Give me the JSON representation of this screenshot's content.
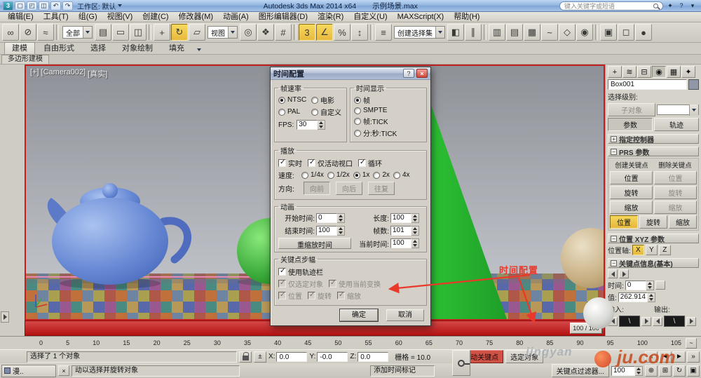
{
  "titlebar": {
    "qat_icons": [
      {
        "name": "app-icon",
        "glyph": "3"
      },
      {
        "name": "new-scene-icon",
        "glyph": "▢"
      },
      {
        "name": "open-file-icon",
        "glyph": "◰"
      },
      {
        "name": "save-file-icon",
        "glyph": "◫"
      },
      {
        "name": "undo-icon",
        "glyph": "↶"
      },
      {
        "name": "redo-icon",
        "glyph": "↷"
      }
    ],
    "workspace_label": "工作区: 默认",
    "app_title": "Autodesk 3ds Max  2014 x64",
    "file_name": "示例场景.max",
    "search_placeholder": "键入关键字或短语",
    "right_icons": [
      {
        "name": "community-icon",
        "glyph": "✦"
      },
      {
        "name": "help-icon",
        "glyph": "?"
      },
      {
        "name": "help-menu-arrow-icon",
        "glyph": "▾"
      }
    ]
  },
  "menubar": {
    "items": [
      "编辑(E)",
      "工具(T)",
      "组(G)",
      "视图(V)",
      "创建(C)",
      "修改器(M)",
      "动画(A)",
      "图形编辑器(D)",
      "渲染(R)",
      "自定义(U)",
      "MAXScript(X)",
      "帮助(H)"
    ]
  },
  "toolbar": {
    "icons": [
      {
        "name": "select-and-link-icon",
        "glyph": "∞"
      },
      {
        "name": "unlink-selection-icon",
        "glyph": "⊘"
      },
      {
        "name": "bind-to-space-warp-icon",
        "glyph": "≈"
      },
      {
        "sep": true
      },
      {
        "name": "selection-filter-combo",
        "combo": "全部"
      },
      {
        "name": "select-by-name-icon",
        "glyph": "▤"
      },
      {
        "name": "selection-region-icon",
        "glyph": "▭"
      },
      {
        "name": "window-crossing-icon",
        "glyph": "◫"
      },
      {
        "sep": true
      },
      {
        "name": "select-and-move-icon",
        "glyph": "+"
      },
      {
        "name": "select-and-rotate-icon",
        "glyph": "↻",
        "pressed": true
      },
      {
        "name": "select-and-scale-icon",
        "glyph": "▱"
      },
      {
        "name": "reference-coordinate-combo",
        "combo": "视图"
      },
      {
        "name": "use-pivot-point-icon",
        "glyph": "◎"
      },
      {
        "name": "select-and-manipulate-icon",
        "glyph": "❖"
      },
      {
        "name": "keyboard-shortcut-override-icon",
        "glyph": "#"
      },
      {
        "sep": true
      },
      {
        "name": "snap-toggle-3d-icon",
        "glyph": "3",
        "pressed": true
      },
      {
        "name": "angle-snap-icon",
        "glyph": "∠",
        "pressed": true
      },
      {
        "name": "percent-snap-icon",
        "glyph": "%"
      },
      {
        "name": "spinner-snap-icon",
        "glyph": "↕"
      },
      {
        "sep": true
      },
      {
        "name": "edit-named-selections-icon",
        "glyph": "≡"
      },
      {
        "name": "named-selection-sets-combo",
        "combo": "创建选择集"
      },
      {
        "name": "mirror-icon",
        "glyph": "◧"
      },
      {
        "name": "align-icon",
        "glyph": "∥"
      },
      {
        "sep": true
      },
      {
        "name": "scene-explorer-icon",
        "glyph": "▥"
      },
      {
        "name": "layer-explorer-icon",
        "glyph": "▤"
      },
      {
        "name": "ribbon-toggle-icon",
        "glyph": "▦"
      },
      {
        "name": "curve-editor-icon",
        "glyph": "~"
      },
      {
        "name": "schematic-view-icon",
        "glyph": "◇"
      },
      {
        "name": "material-editor-icon",
        "glyph": "◉"
      },
      {
        "sep": true
      },
      {
        "name": "render-setup-icon",
        "glyph": "▣"
      },
      {
        "name": "rendered-frame-window-icon",
        "glyph": "◻"
      },
      {
        "name": "render-production-icon",
        "glyph": "●"
      }
    ]
  },
  "ribbon": {
    "tabs": [
      "建模",
      "自由形式",
      "选择",
      "对象绘制",
      "填充"
    ],
    "active_tab": "建模",
    "subtab": "多边形建模"
  },
  "viewport": {
    "label_general": "[+]",
    "label_pov": "[Camera002]",
    "label_shading": "[真实]",
    "time_slider_value": "100 / 100"
  },
  "annotation": {
    "text": "时间配置",
    "color": "#e8392b"
  },
  "dialog": {
    "title": "时间配置",
    "frame_rate": {
      "title": "帧速率",
      "ntsc": "NTSC",
      "film": "电影",
      "pal": "PAL",
      "custom": "自定义",
      "fps_label": "FPS:",
      "fps_value": "30"
    },
    "time_display": {
      "title": "时间显示",
      "frames": "帧",
      "smpte": "SMPTE",
      "frame_tick": "帧:TICK",
      "min_sec_tick": "分:秒:TICK"
    },
    "playback": {
      "title": "播放",
      "realtime": "实时",
      "active_only": "仅活动视口",
      "loop": "循环",
      "speed_label": "速度:",
      "speeds": [
        "1/4x",
        "1/2x",
        "1x",
        "2x",
        "4x"
      ],
      "direction_label": "方向:",
      "forward": "向前",
      "backward": "向后",
      "pingpong": "往复"
    },
    "animation": {
      "title": "动画",
      "start_label": "开始时间:",
      "start_value": "0",
      "length_label": "长度:",
      "length_value": "100",
      "end_label": "结束时间:",
      "end_value": "100",
      "frames_label": "帧数:",
      "frames_value": "101",
      "rescale_btn": "重缩放时间",
      "current_label": "当前时间:",
      "current_value": "100"
    },
    "key_steps": {
      "title": "关键点步幅",
      "use_trackbar": "使用轨迹栏",
      "selected_only": "仅选定对象",
      "use_current_transform": "使用当前变换",
      "position": "位置",
      "rotation": "旋转",
      "scale": "缩放"
    },
    "ok_btn": "确定",
    "cancel_btn": "取消"
  },
  "panel": {
    "tabs": [
      {
        "name": "create-tab-icon",
        "glyph": "+"
      },
      {
        "name": "modify-tab-icon",
        "glyph": "≋"
      },
      {
        "name": "hierarchy-tab-icon",
        "glyph": "⊟"
      },
      {
        "name": "motion-tab-icon",
        "glyph": "◉",
        "active": true
      },
      {
        "name": "display-tab-icon",
        "glyph": "▦"
      },
      {
        "name": "utilities-tab-icon",
        "glyph": "✦"
      }
    ],
    "object_name": "Box001",
    "selection_level_label": "选择级别:",
    "sub_object_label": "子对象",
    "parameters_btn": "参数",
    "trajectories_btn": "轨迹",
    "assign_controller_rollout": "指定控制器",
    "prs_rollout": "PRS 参数",
    "create_key_label": "创建关键点",
    "delete_key_label": "删除关键点",
    "position_label": "位置",
    "rotation_label": "旋转",
    "scale_label": "缩放",
    "pos_xyz_rollout": "位置 XYZ 参数",
    "position_axis_label": "位置轴:",
    "axes": [
      "X",
      "Y",
      "Z"
    ],
    "key_info_rollout": "关键点信息(基本)",
    "time_label": "时间:",
    "time_value": "0",
    "value_label": "值:",
    "value_value": "262.914",
    "in_label": "输入:",
    "out_label": "输出:"
  },
  "timeline": {
    "ticks": [
      "0",
      "5",
      "10",
      "15",
      "20",
      "25",
      "30",
      "35",
      "40",
      "45",
      "50",
      "55",
      "60",
      "65",
      "70",
      "75",
      "80",
      "85",
      "90",
      "95",
      "100",
      "105"
    ],
    "mini_curve_icon": "~"
  },
  "status": {
    "selection_text": "选择了 1 个对象",
    "offset_glyph": "±",
    "coord_labels": {
      "x": "X:",
      "y": "Y:",
      "z": "Z:"
    },
    "coord_values": {
      "x": "0.0",
      "y": "-0.0",
      "z": "0.0"
    },
    "grid_text": "栅格 = 10.0",
    "auto_key": "自动关键点",
    "selected_btn": "选定对象",
    "key_filters_btn": "关键点过滤器...",
    "add_time_tag": "添加时间标记",
    "prompt_text": "动以选择并旋转对象",
    "frame_field": "100",
    "mini_window_title": "漫..",
    "mini_close_glyph": "×",
    "playback_icons": [
      {
        "name": "go-to-start-icon",
        "glyph": "«"
      },
      {
        "name": "previous-frame-icon",
        "glyph": "◄"
      },
      {
        "name": "play-animation-icon",
        "glyph": "►"
      },
      {
        "name": "go-to-end-icon",
        "glyph": "»"
      }
    ],
    "nav_icons": [
      {
        "name": "zoom-icon",
        "glyph": "⊕"
      },
      {
        "name": "zoom-extents-icon",
        "glyph": "⊞"
      },
      {
        "name": "orbit-icon",
        "glyph": "↻"
      },
      {
        "name": "maximize-viewport-toggle-icon",
        "glyph": "▣"
      }
    ]
  },
  "watermarks": {
    "brand1": "jingyan",
    "brand2": "ju.com"
  }
}
